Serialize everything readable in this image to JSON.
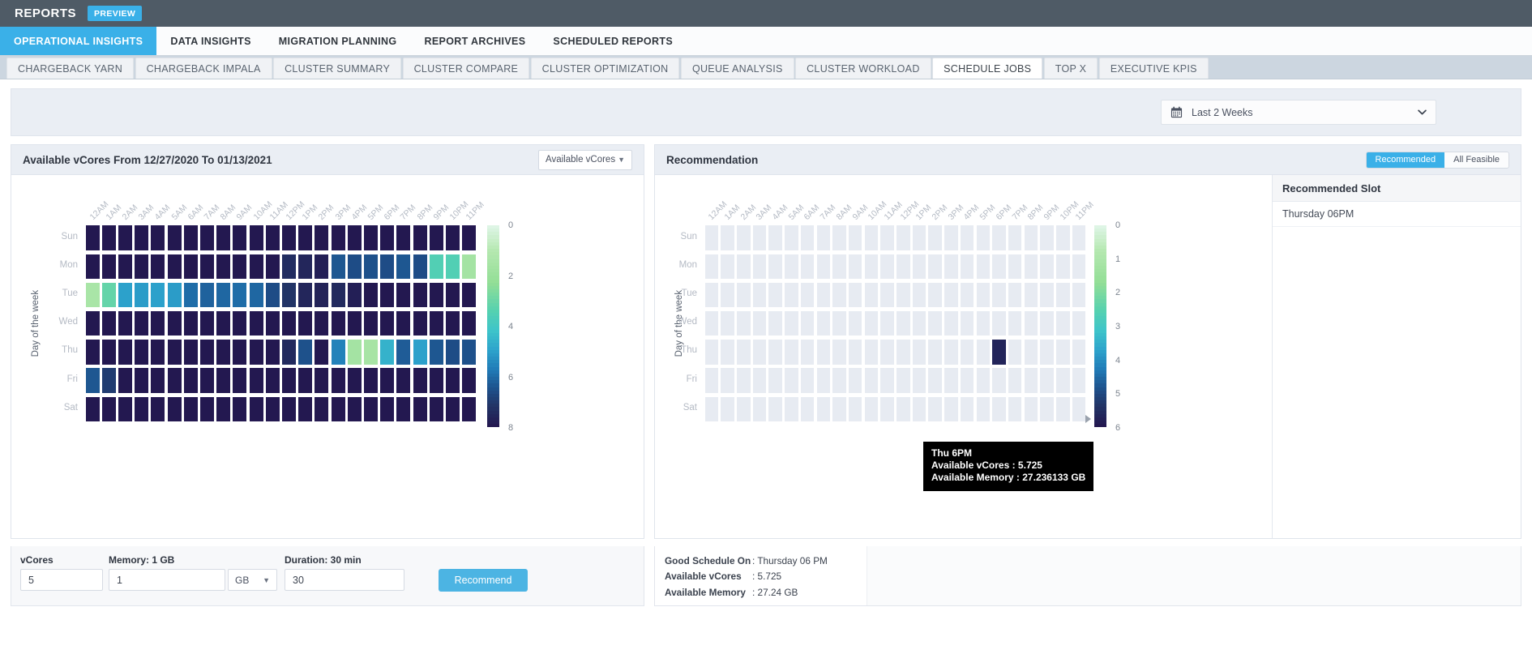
{
  "topbar": {
    "title": "REPORTS",
    "badge": "PREVIEW"
  },
  "primary_tabs": [
    {
      "label": "OPERATIONAL INSIGHTS",
      "active": true
    },
    {
      "label": "DATA INSIGHTS",
      "active": false
    },
    {
      "label": "MIGRATION PLANNING",
      "active": false
    },
    {
      "label": "REPORT ARCHIVES",
      "active": false
    },
    {
      "label": "SCHEDULED REPORTS",
      "active": false
    }
  ],
  "secondary_tabs": [
    {
      "label": "CHARGEBACK YARN",
      "active": false
    },
    {
      "label": "CHARGEBACK IMPALA",
      "active": false
    },
    {
      "label": "CLUSTER SUMMARY",
      "active": false
    },
    {
      "label": "CLUSTER COMPARE",
      "active": false
    },
    {
      "label": "CLUSTER OPTIMIZATION",
      "active": false
    },
    {
      "label": "QUEUE ANALYSIS",
      "active": false
    },
    {
      "label": "CLUSTER WORKLOAD",
      "active": false
    },
    {
      "label": "SCHEDULE JOBS",
      "active": true
    },
    {
      "label": "TOP X",
      "active": false
    },
    {
      "label": "EXECUTIVE KPIS",
      "active": false
    }
  ],
  "filter": {
    "date_range": "Last 2 Weeks",
    "calendar_icon": "calendar-icon",
    "chevron_icon": "chevron-down-icon"
  },
  "left_panel": {
    "title": "Available vCores From 12/27/2020 To 01/13/2021",
    "metric_selected": "Available vCores",
    "caret": "▼"
  },
  "right_panel": {
    "title": "Recommendation",
    "toggle": [
      {
        "label": "Recommended",
        "active": true
      },
      {
        "label": "All Feasible",
        "active": false
      }
    ],
    "slot_header": "Recommended Slot",
    "slots": [
      "Thursday 06PM"
    ],
    "tooltip": {
      "title": "Thu 6PM",
      "lines": [
        "Available vCores : 5.725",
        "Available Memory : 27.236133 GB"
      ]
    }
  },
  "controls": {
    "vcores_label": "vCores",
    "vcores_value": "5",
    "memory_label": "Memory: 1 GB",
    "memory_value": "1",
    "memory_unit": "GB",
    "duration_label": "Duration: 30 min",
    "duration_value": "30",
    "recommend_button": "Recommend"
  },
  "summary": {
    "rows": [
      {
        "key": "Good Schedule On",
        "value": ": Thursday 06 PM"
      },
      {
        "key": "Available vCores",
        "value": ": 5.725"
      },
      {
        "key": "Available Memory",
        "value": ": 27.24 GB"
      }
    ]
  },
  "colors": {
    "accent": "#3ab0e8",
    "topbar": "#4f5b66",
    "panel_head": "#eaeef4",
    "empty_cell": "#e7ebf2"
  },
  "chart_data": [
    {
      "type": "heatmap",
      "id": "available-vcores-heatmap",
      "title": "Available vCores From 12/27/2020 To 01/13/2021",
      "xlabel": "",
      "ylabel": "Day of the week",
      "x": [
        "12AM",
        "1AM",
        "2AM",
        "3AM",
        "4AM",
        "5AM",
        "6AM",
        "7AM",
        "8AM",
        "9AM",
        "10AM",
        "11AM",
        "12PM",
        "1PM",
        "2PM",
        "3PM",
        "4PM",
        "5PM",
        "6PM",
        "7PM",
        "8PM",
        "9PM",
        "10PM",
        "11PM"
      ],
      "y": [
        "Sun",
        "Mon",
        "Tue",
        "Wed",
        "Thu",
        "Fri",
        "Sat"
      ],
      "zlim": [
        0,
        8
      ],
      "legend_ticks": [
        0,
        2,
        4,
        6,
        8
      ],
      "legend_position": "right",
      "colormap": "mako-reversed (light green = low, dark navy = high)",
      "values": [
        [
          8,
          8,
          8,
          8,
          8,
          8,
          8,
          8,
          8,
          8,
          8,
          8,
          8,
          8,
          8,
          8,
          8,
          8,
          8,
          8,
          8,
          8,
          8,
          8
        ],
        [
          8,
          8,
          8,
          8,
          8,
          8,
          8,
          8,
          8,
          8,
          8,
          8,
          7.4,
          7.6,
          7.8,
          6.4,
          6.6,
          6.5,
          6.6,
          6.4,
          6.6,
          3.5,
          3.5,
          1.6
        ],
        [
          1.4,
          3.1,
          5.0,
          5.1,
          5.0,
          5.1,
          6.0,
          6.2,
          6.1,
          6.0,
          6.1,
          6.6,
          7.2,
          7.6,
          7.7,
          7.5,
          7.8,
          8,
          8,
          8,
          8,
          8,
          8,
          8
        ],
        [
          8,
          8,
          8,
          8,
          8,
          8,
          8,
          8,
          8,
          8,
          8,
          8,
          8,
          8,
          8,
          8,
          8,
          8,
          8,
          8,
          8,
          8,
          8,
          8
        ],
        [
          8,
          8,
          8,
          8,
          8,
          8,
          8,
          8,
          8,
          8,
          8,
          8,
          7.5,
          6.5,
          8,
          5.6,
          1.6,
          1.5,
          4.6,
          6.3,
          5.0,
          6.4,
          6.6,
          6.5
        ],
        [
          6.4,
          7.0,
          8,
          8,
          8,
          8,
          8,
          8,
          8,
          8,
          8,
          8,
          8,
          8,
          8,
          8,
          8,
          8,
          8,
          8,
          8,
          8,
          8,
          8
        ],
        [
          8,
          8,
          8,
          8,
          8,
          8,
          8,
          8,
          8,
          8,
          8,
          8,
          8,
          8,
          8,
          8,
          8,
          8,
          8,
          8,
          8,
          8,
          8,
          8
        ]
      ]
    },
    {
      "type": "heatmap",
      "id": "recommendation-heatmap",
      "title": "Recommendation",
      "xlabel": "",
      "ylabel": "Day of the week",
      "x": [
        "12AM",
        "1AM",
        "2AM",
        "3AM",
        "4AM",
        "5AM",
        "6AM",
        "7AM",
        "8AM",
        "9AM",
        "10AM",
        "11AM",
        "12PM",
        "1PM",
        "2PM",
        "3PM",
        "4PM",
        "5PM",
        "6PM",
        "7PM",
        "8PM",
        "9PM",
        "10PM",
        "11PM"
      ],
      "y": [
        "Sun",
        "Mon",
        "Tue",
        "Wed",
        "Thu",
        "Fri",
        "Sat"
      ],
      "zlim": [
        0,
        6
      ],
      "legend_ticks": [
        0,
        1,
        2,
        3,
        4,
        5,
        6
      ],
      "legend_position": "right",
      "colormap": "mako-reversed (light green = low, dark navy = high)",
      "highlighted_cells": [
        {
          "day": "Thu",
          "hour": "6PM",
          "value": 5.725
        }
      ],
      "note": "All cells empty/neutral except the recommended Thu 6PM slot"
    }
  ]
}
